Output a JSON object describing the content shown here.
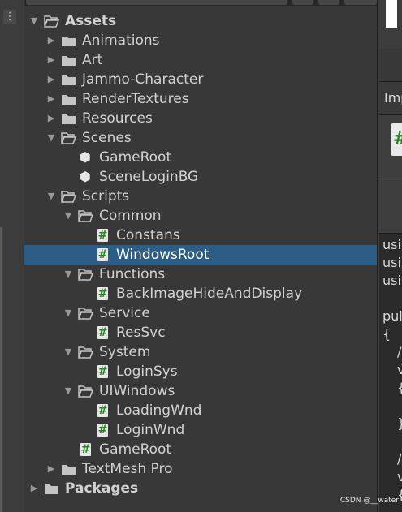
{
  "project_tree": {
    "items": [
      {
        "label": "Assets",
        "depth": 0,
        "expanded": true,
        "kind": "folder-open",
        "bold": true
      },
      {
        "label": "Animations",
        "depth": 1,
        "expanded": false,
        "kind": "folder"
      },
      {
        "label": "Art",
        "depth": 1,
        "expanded": false,
        "kind": "folder"
      },
      {
        "label": "Jammo-Character",
        "depth": 1,
        "expanded": false,
        "kind": "folder"
      },
      {
        "label": "RenderTextures",
        "depth": 1,
        "expanded": false,
        "kind": "folder"
      },
      {
        "label": "Resources",
        "depth": 1,
        "expanded": false,
        "kind": "folder"
      },
      {
        "label": "Scenes",
        "depth": 1,
        "expanded": true,
        "kind": "folder-open"
      },
      {
        "label": "GameRoot",
        "depth": 2,
        "kind": "scene"
      },
      {
        "label": "SceneLoginBG",
        "depth": 2,
        "kind": "scene"
      },
      {
        "label": "Scripts",
        "depth": 1,
        "expanded": true,
        "kind": "folder-open"
      },
      {
        "label": "Common",
        "depth": 2,
        "expanded": true,
        "kind": "folder-open"
      },
      {
        "label": "Constans",
        "depth": 3,
        "kind": "script"
      },
      {
        "label": "WindowsRoot",
        "depth": 3,
        "kind": "script",
        "selected": true
      },
      {
        "label": "Functions",
        "depth": 2,
        "expanded": true,
        "kind": "folder-open"
      },
      {
        "label": "BackImageHideAndDisplay",
        "depth": 3,
        "kind": "script"
      },
      {
        "label": "Service",
        "depth": 2,
        "expanded": true,
        "kind": "folder-open"
      },
      {
        "label": "ResSvc",
        "depth": 3,
        "kind": "script"
      },
      {
        "label": "System",
        "depth": 2,
        "expanded": true,
        "kind": "folder-open"
      },
      {
        "label": "LoginSys",
        "depth": 3,
        "kind": "script"
      },
      {
        "label": "UIWindows",
        "depth": 2,
        "expanded": true,
        "kind": "folder-open"
      },
      {
        "label": "LoadingWnd",
        "depth": 3,
        "kind": "script"
      },
      {
        "label": "LoginWnd",
        "depth": 3,
        "kind": "script"
      },
      {
        "label": "GameRoot",
        "depth": 2,
        "kind": "script"
      },
      {
        "label": "TextMesh Pro",
        "depth": 1,
        "expanded": false,
        "kind": "folder"
      },
      {
        "label": "Packages",
        "depth": 0,
        "expanded": false,
        "kind": "folder",
        "bold": true
      }
    ]
  },
  "left_toolbar": {
    "menu_glyph": "⋮"
  },
  "inspector": {
    "import_label": "Imp",
    "script_glyph": "#",
    "code_lines": [
      "usi",
      "usi",
      "usi",
      "",
      "pul",
      "{",
      "/",
      "v",
      "{",
      "",
      "}",
      "",
      "/",
      "v",
      "{"
    ]
  },
  "watermark": "CSDN @__water",
  "colors": {
    "selection": "#2c5d87",
    "script_hash": "#2b7f2b",
    "background": "#383838"
  }
}
